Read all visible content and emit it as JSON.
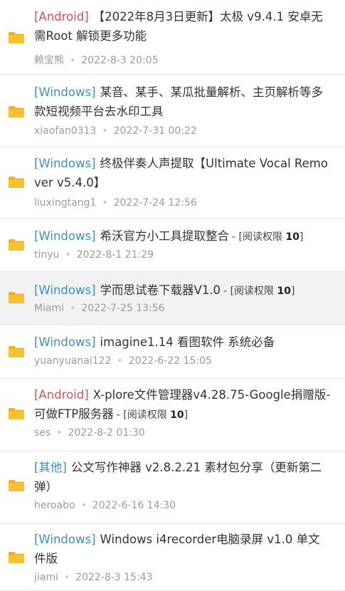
{
  "colors": {
    "android": "#d9534f",
    "windows": "#3d8fc7",
    "other": "#3d8fc7",
    "folder": "#f6c233",
    "folder_tab": "#f0b21c"
  },
  "items": [
    {
      "category": "[Android]",
      "cat_type": "android",
      "title": "【2022年8月3日更新】太极 v9.4.1 安卓无需Root 解锁更多功能",
      "permission": "",
      "author": "赖宝熊",
      "date": "2022-8-3 20:05",
      "icon": "folder-icon"
    },
    {
      "category": "[Windows]",
      "cat_type": "windows",
      "title": "某音、某手、某瓜批量解析、主页解析等多款短视频平台去水印工具",
      "permission": "",
      "author": "xiaofan0313",
      "date": "2022-7-31 00:22",
      "icon": "folder-icon"
    },
    {
      "category": "[Windows]",
      "cat_type": "windows",
      "title": "终极伴奏人声提取【Ultimate Vocal Remover v5.4.0】",
      "permission": "",
      "author": "liuxingtang1",
      "date": "2022-7-24 12:56",
      "icon": "folder-icon"
    },
    {
      "category": "[Windows]",
      "cat_type": "windows",
      "title": "希沃官方小工具提取整合",
      "permission": "- [阅读权限 10]",
      "author": "tinyu",
      "date": "2022-8-1 21:29",
      "icon": "folder-icon"
    },
    {
      "category": "[Windows]",
      "cat_type": "windows",
      "title": "学而思试卷下载器V1.0",
      "permission": "- [阅读权限 10]",
      "author": "Miami",
      "date": "2022-7-25 13:56",
      "icon": "folder-icon",
      "selected": true
    },
    {
      "category": "[Windows]",
      "cat_type": "windows",
      "title": "imagine1.14 看图软件 系统必备",
      "permission": "",
      "author": "yuanyuanai122",
      "date": "2022-6-22 15:05",
      "icon": "folder-icon"
    },
    {
      "category": "[Android]",
      "cat_type": "android",
      "title": "X-plore文件管理器v4.28.75-Google捐赠版-可做FTP服务器",
      "permission": "- [阅读权限 10]",
      "author": "ses",
      "date": "2022-8-2 01:30",
      "icon": "folder-icon"
    },
    {
      "category": "[其他]",
      "cat_type": "other",
      "title": "公文写作神器 v2.8.2.21 素材包分享（更新第二弹）",
      "permission": "",
      "author": "heroabo",
      "date": "2022-6-16 14:30",
      "icon": "folder-icon"
    },
    {
      "category": "[Windows]",
      "cat_type": "windows",
      "title": "Windows i4recorder电脑录屏 v1.0 单文件版",
      "permission": "",
      "author": "jiami",
      "date": "2022-8-3 15:43",
      "icon": "folder-icon"
    }
  ]
}
